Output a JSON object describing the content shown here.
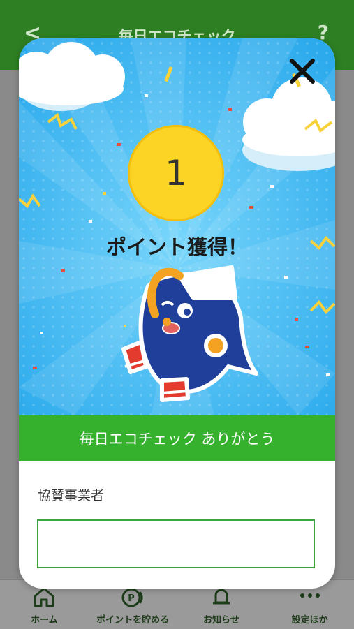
{
  "app_header": {
    "back_glyph": "<",
    "title": "毎日エコチェック",
    "help_glyph": "?"
  },
  "modal": {
    "points": "1",
    "headline": "ポイント獲得！",
    "close_icon": "close-icon",
    "banner": "毎日エコチェック ありがとう",
    "sponsor_label": "協賛事業者",
    "sponsor_value": ""
  },
  "tabs": [
    {
      "label": "ホーム",
      "icon": "home-icon"
    },
    {
      "label": "ポイントを貯める",
      "icon": "points-icon"
    },
    {
      "label": "お知らせ",
      "icon": "bell-icon"
    },
    {
      "label": "設定ほか",
      "icon": "more-icon"
    }
  ],
  "colors": {
    "header_green": "#2e7f24",
    "banner_green": "#35b12e",
    "sky_blue": "#2fb2ef",
    "coin_yellow": "#fcd425"
  }
}
